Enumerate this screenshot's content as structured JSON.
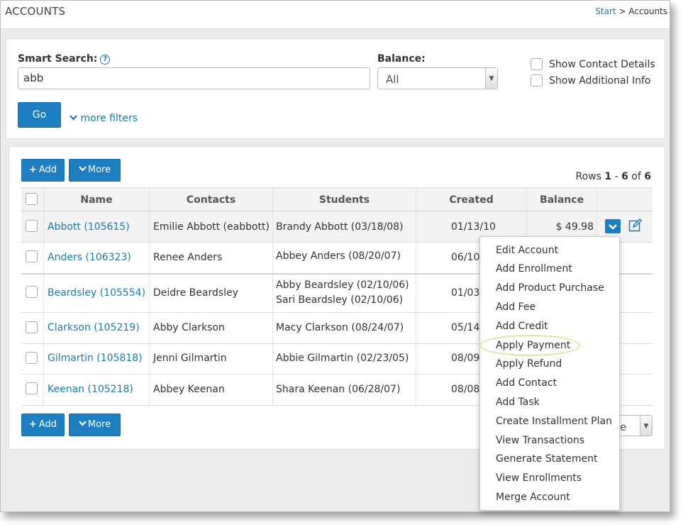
{
  "page": {
    "title": "ACCOUNTS"
  },
  "breadcrumb": {
    "start": "Start",
    "separator": ">",
    "current": "Accounts"
  },
  "search": {
    "smart_search_label": "Smart Search:",
    "help_glyph": "?",
    "smart_search_value": "abb",
    "balance_label": "Balance:",
    "balance_value": "All",
    "show_contact_details": "Show Contact Details",
    "show_additional_info": "Show Additional Info",
    "go_label": "Go",
    "more_filters_label": "more filters"
  },
  "toolbar": {
    "add_label": "Add",
    "more_label": "More"
  },
  "rows_info": {
    "prefix": "Rows",
    "from": "1",
    "dash": "-",
    "to": "6",
    "of": "of",
    "total": "6"
  },
  "table": {
    "columns": [
      "Name",
      "Contacts",
      "Students",
      "Created",
      "Balance"
    ],
    "rows": [
      {
        "name": "Abbott (105615)",
        "contact": "Emilie Abbott (eabbott)",
        "students": [
          "Brandy Abbott (03/18/08)"
        ],
        "created": "01/13/10",
        "balance": "$ 49.98"
      },
      {
        "name": "Anders (106323)",
        "contact": "Renee Anders",
        "students": [
          "Abbey Anders (08/20/07)"
        ],
        "created": "06/10/",
        "balance": ""
      },
      {
        "name": "Beardsley (105554)",
        "contact": "Deidre Beardsley",
        "students": [
          "Abby Beardsley (02/10/06)",
          "Sari Beardsley (02/10/06)"
        ],
        "created": "01/03/",
        "balance": ""
      },
      {
        "name": "Clarkson (105219)",
        "contact": "Abby Clarkson",
        "students": [
          "Macy Clarkson (08/24/07)"
        ],
        "created": "05/14/",
        "balance": ""
      },
      {
        "name": "Gilmartin (105818)",
        "contact": "Jenni Gilmartin",
        "students": [
          "Abbie Gilmartin (02/23/05)"
        ],
        "created": "08/09/",
        "balance": ""
      },
      {
        "name": "Keenan (105218)",
        "contact": "Abbey Keenan",
        "students": [
          "Shara Keenan (06/28/07)"
        ],
        "created": "08/08/",
        "balance": ""
      }
    ]
  },
  "action_menu": {
    "items": [
      "Edit Account",
      "Add Enrollment",
      "Add Product Purchase",
      "Add Fee",
      "Add Credit",
      "Apply Payment",
      "Apply Refund",
      "Add Contact",
      "Add Task",
      "Create Installment Plan",
      "View Transactions",
      "Generate Statement",
      "View Enrollments",
      "Merge Account"
    ],
    "highlighted": "Apply Payment"
  },
  "pager": {
    "visible_fragment": "e"
  },
  "colors": {
    "primary": "#1d7fc2",
    "link": "#1a7ab8",
    "highlight_ring": "#d4ea9a"
  }
}
